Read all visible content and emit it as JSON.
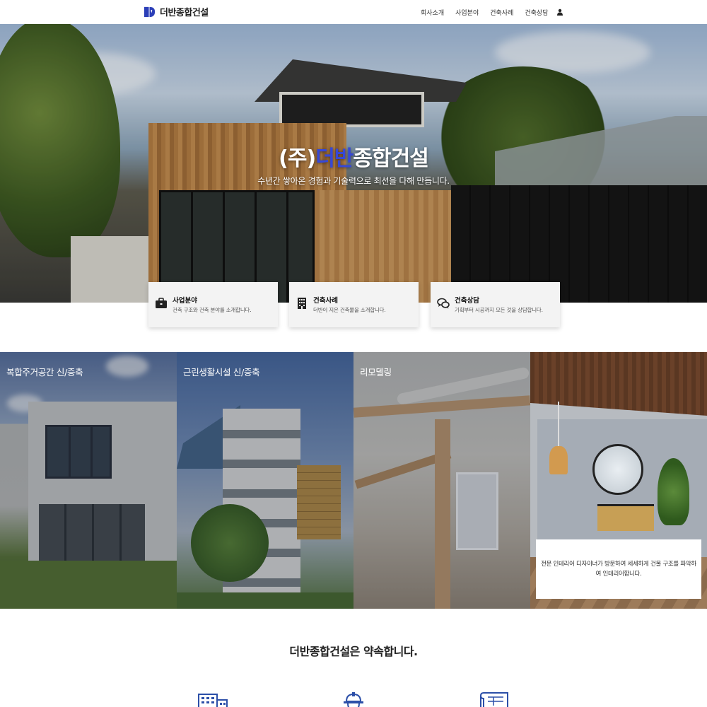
{
  "header": {
    "logo_text": "더반종합건설",
    "nav": [
      "회사소개",
      "사업분야",
      "건축사례",
      "건축상담"
    ],
    "user_icon": "user-icon",
    "brand_color": "#2c3fb8"
  },
  "hero": {
    "title_prefix": "(주)",
    "title_accent": "더반",
    "title_suffix": "종합건설",
    "subtitle": "수년간 쌓아온 경험과 기술력으로 최선을 다해 만듭니다.",
    "accent_color": "#3648d6"
  },
  "cards": [
    {
      "icon": "briefcase-icon",
      "title": "사업분야",
      "desc": "건축 구조와 건축 분야를 소개합니다."
    },
    {
      "icon": "building-icon",
      "title": "건축사례",
      "desc": "더반이 지은 건축물을 소개합니다."
    },
    {
      "icon": "chat-icon",
      "title": "건축상담",
      "desc": "기획부터 시공까지 모든 것을 상담합니다."
    }
  ],
  "tiles": [
    {
      "label": "복합주거공간 신/증축"
    },
    {
      "label": "근린생활시설 신/증축"
    },
    {
      "label": "리모델링"
    },
    {
      "label": "",
      "desc": "전문 인테리어 디자이너가 방문하여 세세하게 건물 구조를 파악하여 인테리어합니다."
    }
  ],
  "promise": {
    "title": "더반종합건설은 약속합니다.",
    "icons": [
      "office-building-icon",
      "worker-icon",
      "blueprint-icon"
    ],
    "icon_color": "#2c4fa8"
  }
}
